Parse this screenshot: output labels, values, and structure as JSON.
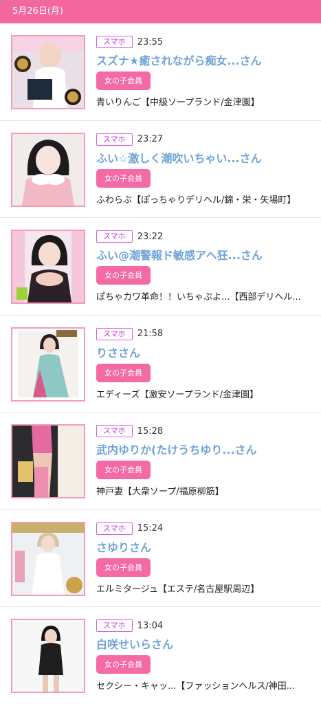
{
  "header": {
    "date": "5月26日(月)"
  },
  "colors": {
    "accent": "#f2679e",
    "name": "#6fa3d8",
    "tag": "#c035d6",
    "badge": "#f46aa5"
  },
  "entries": [
    {
      "device": "スマホ",
      "time": "23:55",
      "name": "スズナ★癒されながら痴女...さん",
      "badge": "女の子会員",
      "shop": "青いりんご【中級ソープランド/金津園】",
      "thumb_icon": "woman-photo-icon"
    },
    {
      "device": "スマホ",
      "time": "23:27",
      "name": "ふい☆激しく潮吹いちゃい...さん",
      "badge": "女の子会員",
      "shop": "ふわらぶ【ぽっちゃりデリヘル/錦・栄・矢場町】",
      "thumb_icon": "woman-photo-icon"
    },
    {
      "device": "スマホ",
      "time": "23:22",
      "name": "ふい@潮警報ド敏感アヘ狂...さん",
      "badge": "女の子会員",
      "shop": "ぽちゃカワ革命！！いちゃぷよ...【西部デリヘル...",
      "thumb_icon": "woman-photo-icon"
    },
    {
      "device": "スマホ",
      "time": "21:58",
      "name": "りささん",
      "badge": "女の子会員",
      "shop": "エディーズ【激安ソープランド/金津園】",
      "thumb_icon": "woman-photo-icon"
    },
    {
      "device": "スマホ",
      "time": "15:28",
      "name": "武内ゆりか(たけうちゆり...さん",
      "badge": "女の子会員",
      "shop": "神戸妻【大衆ソープ/福原柳筋】",
      "thumb_icon": "woman-photo-icon"
    },
    {
      "device": "スマホ",
      "time": "15:24",
      "name": "さゆりさん",
      "badge": "女の子会員",
      "shop": "エルミタージュ【エステ/名古屋駅周辺】",
      "thumb_icon": "woman-photo-icon"
    },
    {
      "device": "スマホ",
      "time": "13:04",
      "name": "白咲せいらさん",
      "badge": "女の子会員",
      "shop": "セクシー・キャッ...【ファッションヘルス/神田...",
      "thumb_icon": "woman-photo-icon"
    }
  ]
}
